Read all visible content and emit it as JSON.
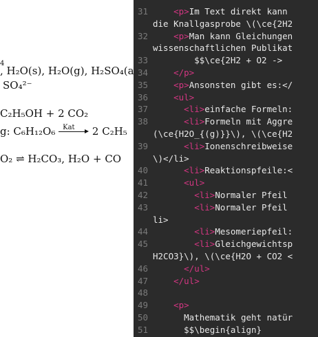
{
  "preview": {
    "row1_text": ", H₂O(s), H₂O(g), H₂SO₄(a",
    "row2_text": "SO₄²⁻",
    "row3_text": "C₂H₅OH + 2 CO₂",
    "row4_prefix": "g: C₆H₁₂O₆",
    "row4_catalyst": "Kat",
    "row4_product": "2 C₂H₅",
    "row5_text": "O₂ ⇌ H₂CO₃, H₂O + CO",
    "sup_fragment": "4"
  },
  "editor": {
    "lines": [
      {
        "num": "31",
        "indent": "    ",
        "tag": "<p>",
        "text": "Im Text direkt kann"
      },
      {
        "num": "",
        "indent": "",
        "tag": "",
        "text": "die Knallgasprobe \\(\\ce{2H2"
      },
      {
        "num": "32",
        "indent": "    ",
        "tag": "<p>",
        "text": "Man kann Gleichungen"
      },
      {
        "num": "",
        "indent": "",
        "tag": "",
        "text": "wissenschaftlichen Publikat"
      },
      {
        "num": "33",
        "indent": "        ",
        "tag": "",
        "text": "$$\\ce{2H2 + O2 ->"
      },
      {
        "num": "34",
        "indent": "    ",
        "tag": "</p>",
        "text": ""
      },
      {
        "num": "35",
        "indent": "    ",
        "tag": "<p>",
        "text": "Ansonsten gibt es:</"
      },
      {
        "num": "36",
        "indent": "    ",
        "tag": "<ul>",
        "text": ""
      },
      {
        "num": "37",
        "indent": "      ",
        "tag": "<li>",
        "text": "einfache Formeln:"
      },
      {
        "num": "38",
        "indent": "      ",
        "tag": "<li>",
        "text": "Formeln mit Aggre"
      },
      {
        "num": "",
        "indent": "",
        "tag": "",
        "text": "(\\ce{H2O_{(g)}}\\), \\(\\ce{H2"
      },
      {
        "num": "39",
        "indent": "      ",
        "tag": "<li>",
        "text": "Ionenschreibweise"
      },
      {
        "num": "",
        "indent": "",
        "tag": "",
        "text": "\\)</li>"
      },
      {
        "num": "40",
        "indent": "      ",
        "tag": "<li>",
        "text": "Reaktionspfeile:<"
      },
      {
        "num": "41",
        "indent": "      ",
        "tag": "<ul>",
        "text": ""
      },
      {
        "num": "42",
        "indent": "        ",
        "tag": "<li>",
        "text": "Normaler Pfeil"
      },
      {
        "num": "43",
        "indent": "        ",
        "tag": "<li>",
        "text": "Normaler Pfeil"
      },
      {
        "num": "",
        "indent": "",
        "tag": "",
        "text": "li>"
      },
      {
        "num": "44",
        "indent": "        ",
        "tag": "<li>",
        "text": "Mesomeriepfeil:"
      },
      {
        "num": "45",
        "indent": "        ",
        "tag": "<li>",
        "text": "Gleichgewichtsp"
      },
      {
        "num": "",
        "indent": "",
        "tag": "",
        "text": "H2CO3}\\), \\(\\ce{H2O + CO2 <"
      },
      {
        "num": "46",
        "indent": "      ",
        "tag": "</ul>",
        "text": ""
      },
      {
        "num": "47",
        "indent": "    ",
        "tag": "</ul>",
        "text": ""
      },
      {
        "num": "48",
        "indent": "",
        "tag": "",
        "text": ""
      },
      {
        "num": "49",
        "indent": "    ",
        "tag": "<p>",
        "text": ""
      },
      {
        "num": "50",
        "indent": "      ",
        "tag": "",
        "text": "Mathematik geht natür"
      },
      {
        "num": "51",
        "indent": "      ",
        "tag": "",
        "text": "$$\\begin{align}"
      }
    ]
  }
}
